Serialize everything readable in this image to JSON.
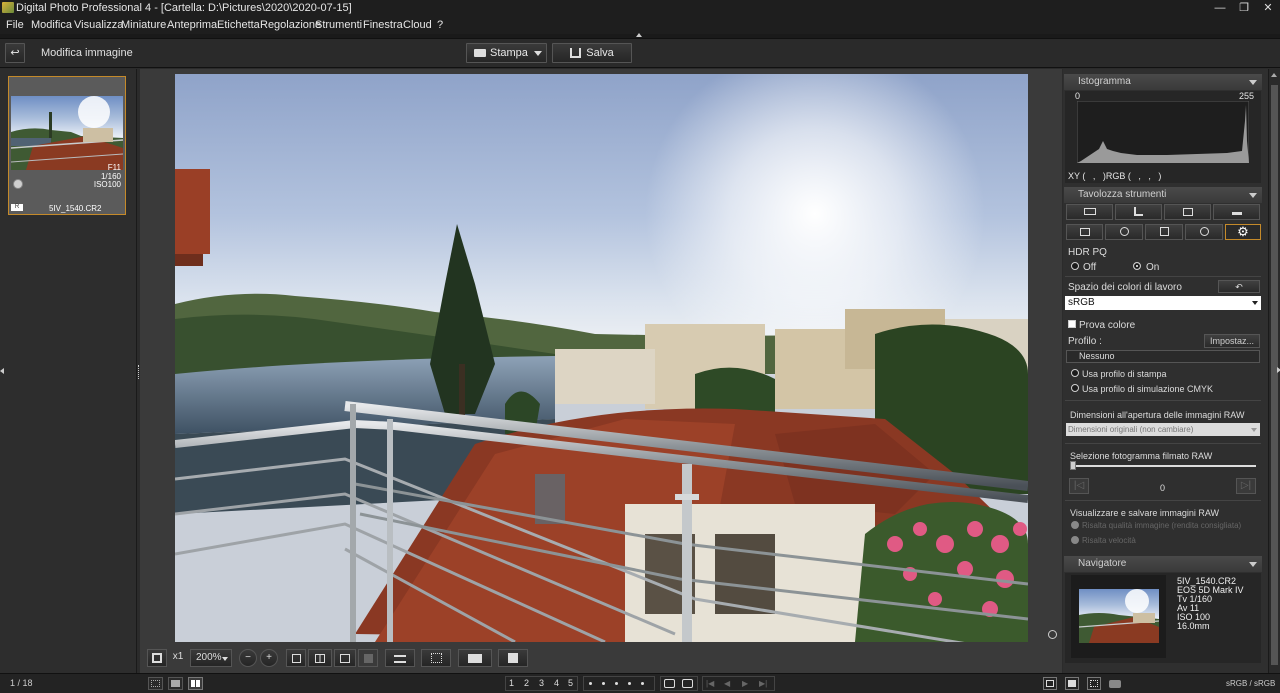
{
  "window": {
    "title": "Digital Photo Professional 4 - [Cartella: D:\\Pictures\\2020\\2020-07-15]",
    "minimize": "—",
    "restore": "❐",
    "close": "✕"
  },
  "menu": [
    "File",
    "Modifica",
    "Visualizza",
    "Miniature",
    "Anteprima",
    "Etichetta",
    "Regolazione",
    "Strumenti",
    "Finestra",
    "Cloud",
    "?"
  ],
  "toolbar": {
    "back_icon": "↩",
    "mode_label": "Modifica immagine",
    "print_label": "Stampa",
    "save_label": "Salva"
  },
  "thumbnail": {
    "aperture": "F11",
    "shutter": "1/160",
    "iso": "ISO100",
    "filename": "5IV_1540.CR2",
    "badge": "R"
  },
  "histogram": {
    "title": "Istogramma",
    "min_label": "0",
    "max_label": "255",
    "readout": "XY (   ,   )RGB (   ,   ,   )"
  },
  "tool_palette": {
    "title": "Tavolozza strumenti",
    "hdr_pq_label": "HDR PQ",
    "hdr_off": "Off",
    "hdr_on": "On",
    "hdr_selected": "On",
    "color_space_label": "Spazio dei colori di lavoro",
    "color_space_value": "sRGB",
    "soft_proof_label": "Prova colore",
    "profile_label": "Profilo :",
    "settings_button": "Impostaz...",
    "profile_value": "Nessuno",
    "use_print_profile": "Usa profilo di stampa",
    "use_cmyk_profile": "Usa profilo di simulazione CMYK",
    "raw_open_size_label": "Dimensioni all'apertura delle immagini RAW",
    "raw_open_size_value": "Dimensioni originali (non cambiare)",
    "raw_movie_frame_label": "Selezione fotogramma filmato RAW",
    "raw_movie_frame_value": "0",
    "raw_movie_frame_position": 0,
    "view_save_raw_label": "Visualizzare e salvare immagini RAW",
    "high_quality_option": "Risalta qualità immagine (rendita consigliata)",
    "high_speed_option": "Risalta velocità"
  },
  "navigator": {
    "title": "Navigatore",
    "filename": "5IV_1540.CR2",
    "camera": "EOS 5D Mark IV",
    "tv": "Tv 1/160",
    "av": "Av 11",
    "iso": "ISO 100",
    "focal": "16.0mm"
  },
  "view_toolbar": {
    "zoom_x1": "x1",
    "zoom_value": "200%",
    "zoom_out": "−",
    "zoom_in": "+"
  },
  "status": {
    "count": "1 / 18",
    "ratings": [
      "1",
      "2",
      "3",
      "4",
      "5"
    ],
    "color_space": "sRGB / sRGB"
  },
  "colors": {
    "accent": "#c58a2a",
    "panel": "#2f2f2f",
    "background": "#2b2b2b"
  }
}
